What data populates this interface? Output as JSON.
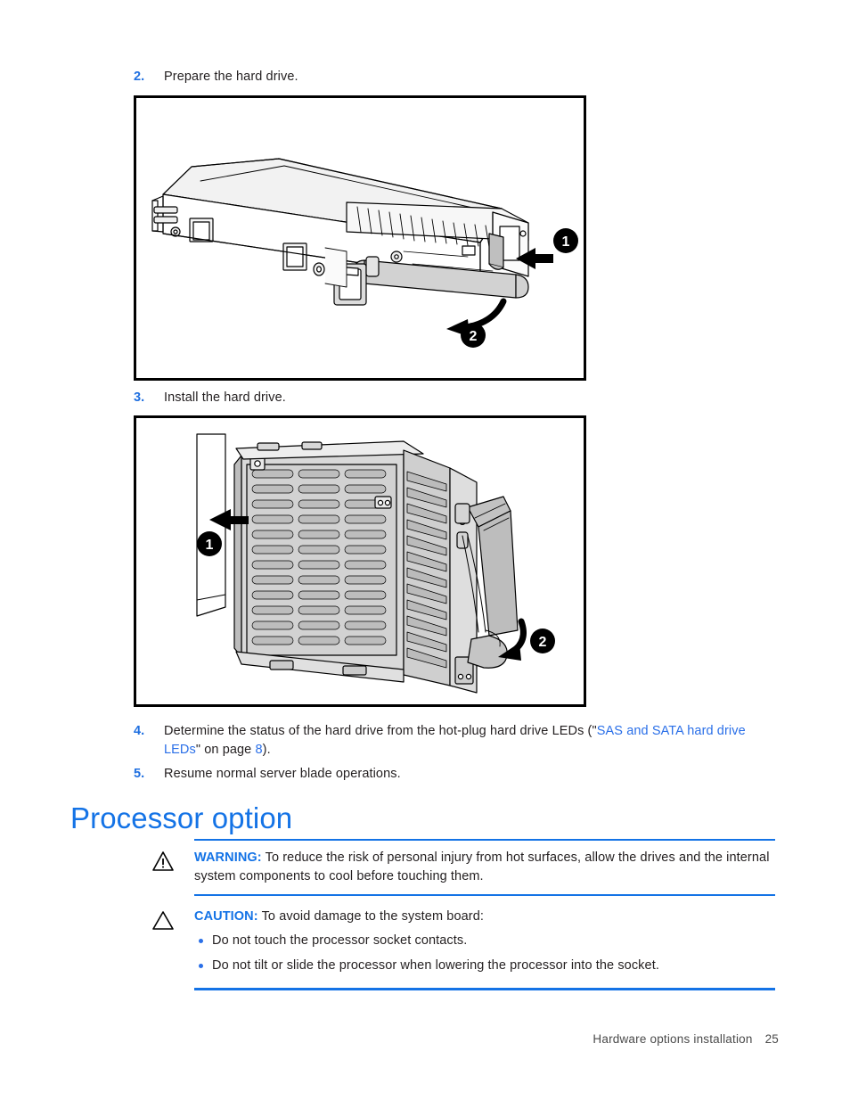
{
  "steps": [
    {
      "num": "2.",
      "text": "Prepare the hard drive."
    },
    {
      "num": "3.",
      "text": "Install the hard drive."
    }
  ],
  "step4": {
    "num": "4.",
    "pre": "Determine the status of the hard drive from the hot-plug hard drive LEDs (\"",
    "link": "SAS and SATA hard drive LEDs",
    "mid": "\" on page ",
    "page_link": "8",
    "post": ")."
  },
  "step5": {
    "num": "5.",
    "text": "Resume normal server blade operations."
  },
  "heading": "Processor option",
  "warning": {
    "icon": "warning-triangle-exclamation-icon",
    "label": "WARNING:",
    "text": "To reduce the risk of personal injury from hot surfaces, allow the drives and the internal system components to cool before touching them."
  },
  "caution": {
    "icon": "caution-triangle-icon",
    "label": "CAUTION:",
    "text": "To avoid damage to the system board:",
    "bullets": [
      "Do not touch the processor socket contacts.",
      "Do not tilt or slide the processor when lowering the processor into the socket."
    ]
  },
  "figures": {
    "prepare_drive": {
      "name": "hard-drive-carrier-prepare-illustration",
      "callout1": "1",
      "callout2": "2"
    },
    "install_drive": {
      "name": "hard-drive-install-illustration",
      "callout1": "1",
      "callout2": "2"
    }
  },
  "footer": {
    "chapter": "Hardware options installation",
    "page_number": "25"
  },
  "colors": {
    "accent_blue": "#1473e6",
    "link_blue": "#2a6fe8",
    "body_text": "#231f20",
    "line_art": "#000000",
    "fill_light": "#e8e8e8",
    "fill_mid": "#c9c9c9",
    "fill_dark": "#a8a8a8"
  }
}
